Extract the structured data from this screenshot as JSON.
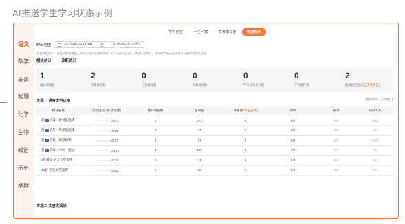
{
  "page_title": "AI推送学生学习状态示例",
  "subjects": [
    "语文",
    "数学",
    "英语",
    "物理",
    "化学",
    "生物",
    "政治",
    "历史",
    "地理"
  ],
  "active_subject": "语文",
  "top_tabs": [
    "学习内容",
    "一生一案",
    "高考模拟卷",
    "数据统计"
  ],
  "active_top_tab": "数据统计",
  "time_range": {
    "label": "时间范围",
    "start": "2025-05-06 00:00",
    "separator": "至",
    "end": "2025-05-06 23:59"
  },
  "description": "表格数据定义：表格的数据根据上方统计时间范围的控制，在不同时间范围下数据存在差异，统计数字表示在该时间范围内的数据状态",
  "sub_tabs": [
    "模块统计",
    "诊断统计"
  ],
  "active_sub_tab": "模块统计",
  "stats": [
    {
      "value": "1",
      "label": "做对试题数"
    },
    {
      "value": "2",
      "label": "待重做错题"
    },
    {
      "value": "0",
      "label": "已重做错题"
    },
    {
      "value": "0",
      "label": "观看微课数"
    },
    {
      "value": "0",
      "label": "学习知识卡片数"
    },
    {
      "value": "0",
      "label": "学习课件数"
    },
    {
      "value": "2",
      "label": "数据报告数",
      "link": "(点击查看报告)"
    }
  ],
  "section1": {
    "title": "专题一 语言文字运用",
    "update_label": "更新时间：实时统计"
  },
  "table": {
    "headers": [
      "模块名称",
      "试题进度 (做对/总数)",
      "做对试题数",
      "总试题",
      "待重做",
      "(点击查看)",
      "课件",
      "微课",
      "知识卡片"
    ],
    "rows": [
      {
        "pre": "第",
        "tag": "1",
        "post": "阶段：教材基础练",
        "progress": "0/272",
        "fraction": 0,
        "correct": "0",
        "total": "272",
        "redo": "0",
        "courseware": "0/0",
        "microclass": "0/0",
        "cards": "0/43"
      },
      {
        "pre": "第",
        "tag": "2",
        "post": "阶段：高考基础练",
        "progress": "0/23",
        "fraction": 0,
        "correct": "0",
        "total": "23",
        "redo": "0",
        "courseware": "0/0",
        "microclass": "0/0",
        "cards": "0/0"
      },
      {
        "pre": "第",
        "tag": "3",
        "post": "阶段：解题精练",
        "progress": "0/77",
        "fraction": 0,
        "correct": "0",
        "total": "77",
        "redo": "0",
        "courseware": "0/0",
        "microclass": "0/0",
        "cards": "0/26"
      },
      {
        "pre": "第",
        "tag": "4",
        "post": "阶段：冲刺一遍过",
        "progress": "0/105",
        "fraction": 0,
        "correct": "0",
        "total": "105",
        "redo": "0",
        "courseware": "0/0",
        "microclass": "0/0",
        "cards": "0/0"
      },
      {
        "pre": "",
        "tag": "",
        "post": "3月最新·语言文字运用",
        "progress": "0/34",
        "fraction": 0,
        "correct": "0",
        "total": "34",
        "redo": "0",
        "courseware": "0/0",
        "microclass": "0/0",
        "cards": "0/0"
      },
      {
        "pre": "",
        "tag": "",
        "post": "45套·语言文字运用",
        "progress": "0/82",
        "fraction": 0,
        "correct": "0",
        "total": "82",
        "redo": "0",
        "courseware": "0/0",
        "microclass": "0/0",
        "cards": "0/0"
      }
    ]
  },
  "section2": {
    "title": "专题二 文言文阅读"
  },
  "colors": {
    "accent": "#e8641c",
    "frame_border": "#e87a4a",
    "frame_bg": "#fdf2ec",
    "tag_bg": "#4a5a8a"
  }
}
